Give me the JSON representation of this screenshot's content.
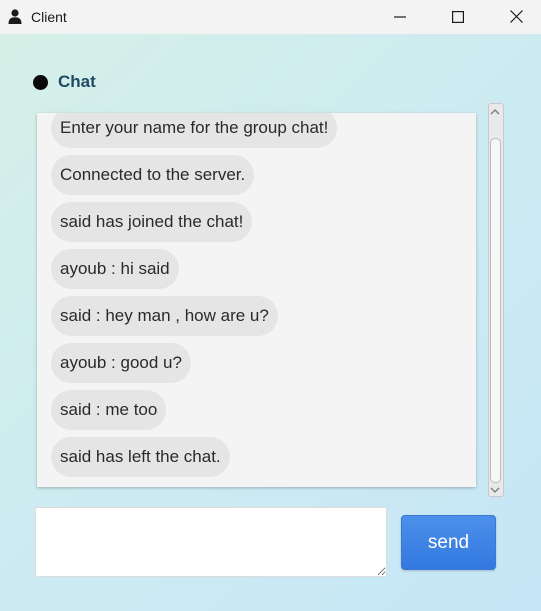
{
  "window": {
    "title": "Client",
    "icon": "user-icon"
  },
  "window_controls": [
    "minimize-icon",
    "maximize-icon",
    "close-icon"
  ],
  "chat": {
    "title": "Chat",
    "status_dot_color": "#0a0a0a",
    "messages": [
      "Enter your name for the group chat!",
      "Connected to the server.",
      "said has joined the chat!",
      "ayoub : hi said",
      "said : hey man , how are u?",
      "ayoub : good u?",
      "said : me too",
      "said has left the chat."
    ]
  },
  "composer": {
    "input_value": "",
    "send_label": "send"
  },
  "colors": {
    "accent": "#3a7fe3",
    "title_color": "#1f4b63",
    "bubble": "#e5e5e5"
  }
}
